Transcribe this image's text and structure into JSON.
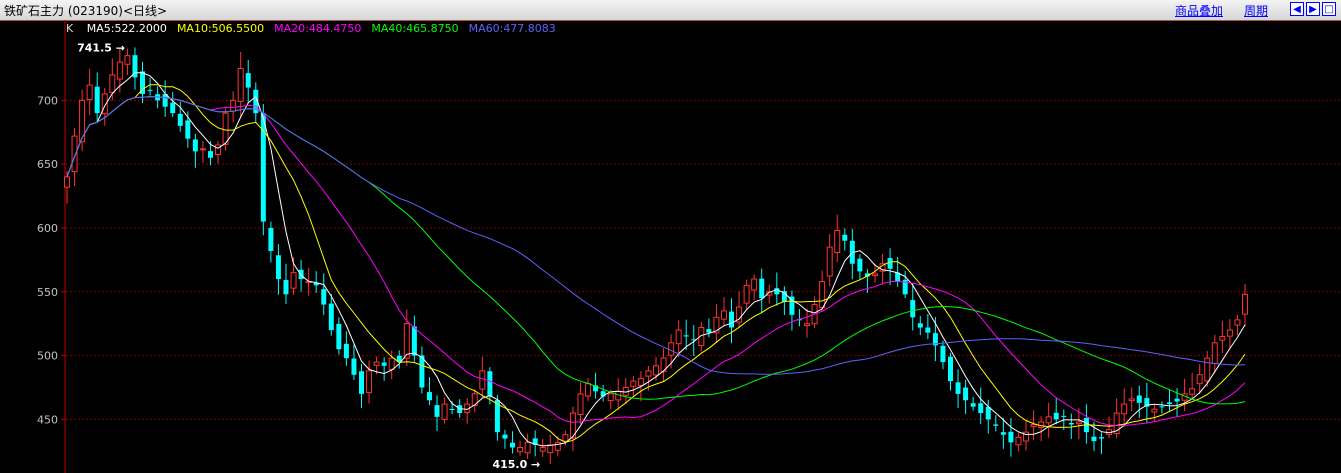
{
  "title": "铁矿石主力 (023190)<日线>",
  "toolbar": {
    "compare_label": "商品叠加",
    "period_label": "周期"
  },
  "chart_data": {
    "type": "candlestick",
    "y_range": [
      415,
      741.5
    ],
    "y_ticks": [
      450,
      500,
      550,
      600,
      650,
      700
    ],
    "grid": "horizontal dotted",
    "legend": {
      "prefix": "K",
      "items": [
        {
          "name": "MA5",
          "label": "MA5:522.2000",
          "color": "#ffffff"
        },
        {
          "name": "MA10",
          "label": "MA10:506.5500",
          "color": "#ffff00"
        },
        {
          "name": "MA20",
          "label": "MA20:484.4750",
          "color": "#ff00ff"
        },
        {
          "name": "MA40",
          "label": "MA40:465.8750",
          "color": "#00ff00"
        },
        {
          "name": "MA60",
          "label": "MA60:477.8083",
          "color": "#6060ff"
        }
      ]
    },
    "annotations": [
      {
        "label": "741.5",
        "value": 741.5,
        "kind": "high"
      },
      {
        "label": "415.0",
        "value": 415.0,
        "kind": "low"
      }
    ],
    "colors": {
      "up": "#ff3232",
      "down": "#00ffff",
      "grid": "#8c0000",
      "axis": "#c00000",
      "tick_text": "#c0c0c0"
    },
    "close": [
      640,
      672,
      700,
      712,
      690,
      705,
      720,
      730,
      735,
      718,
      705,
      708,
      700,
      695,
      690,
      680,
      670,
      660,
      662,
      655,
      665,
      690,
      700,
      725,
      710,
      690,
      605,
      582,
      560,
      548,
      565,
      560,
      558,
      555,
      540,
      520,
      505,
      498,
      485,
      470,
      488,
      495,
      492,
      498,
      495,
      525,
      500,
      475,
      465,
      452,
      462,
      458,
      455,
      462,
      470,
      488,
      468,
      440,
      435,
      428,
      428,
      432,
      430,
      428,
      430,
      432,
      438,
      455,
      470,
      478,
      472,
      468,
      470,
      472,
      475,
      480,
      482,
      488,
      492,
      498,
      510,
      520,
      515,
      512,
      522,
      518,
      530,
      535,
      522,
      538,
      555,
      560,
      545,
      550,
      548,
      542,
      532,
      528,
      525,
      540,
      558,
      585,
      598,
      590,
      572,
      566,
      562,
      564,
      572,
      568,
      558,
      548,
      530,
      522,
      518,
      508,
      495,
      480,
      470,
      465,
      460,
      455,
      450,
      445,
      438,
      432,
      436,
      440,
      446,
      448,
      452,
      450,
      452,
      446,
      448,
      440,
      433,
      435,
      442,
      455,
      462,
      466,
      463,
      460,
      458,
      460,
      462,
      464,
      470,
      474,
      485,
      498,
      510,
      515,
      520,
      528,
      548
    ]
  }
}
